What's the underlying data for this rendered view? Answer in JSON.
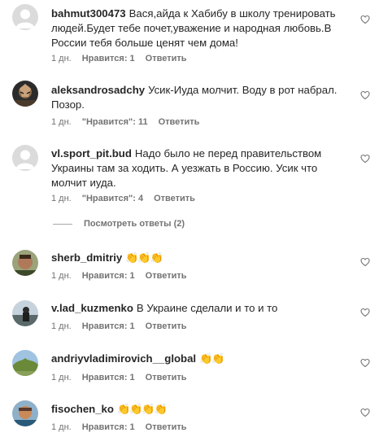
{
  "comments": [
    {
      "username": "bahmut300473",
      "text": "Вася,айда к Хабибу в школу тренировать людей.Будет тебе почет,уважение и народная любовь.В России тебя больше ценят чем дома!",
      "time": "1 дн.",
      "likes": "Нравится: 1",
      "reply": "Ответить"
    },
    {
      "username": "aleksandrosadchy",
      "text": "Усик-Иуда молчит. Воду в рот набрал. Позор.",
      "time": "1 дн.",
      "likes": "\"Нравится\": 11",
      "reply": "Ответить"
    },
    {
      "username": "vl.sport_pit.bud",
      "text": "Надо было не перед правительством Украины там за ходить. А уезжать в Россию. Усик что молчит иуда.",
      "time": "1 дн.",
      "likes": "\"Нравится\": 4",
      "reply": "Ответить"
    },
    {
      "username": "sherb_dmitriy",
      "text": "👏👏👏",
      "time": "1 дн.",
      "likes": "Нравится: 1",
      "reply": "Ответить"
    },
    {
      "username": "v.lad_kuzmenko",
      "text": "В Украине сделали и то и то",
      "time": "1 дн.",
      "likes": "Нравится: 1",
      "reply": "Ответить"
    },
    {
      "username": "andriyvladimirovich__global",
      "text": "👏👏",
      "time": "1 дн.",
      "likes": "Нравится: 1",
      "reply": "Ответить"
    },
    {
      "username": "fisochen_ko",
      "text": "👏👏👏👏",
      "time": "1 дн.",
      "likes": "Нравится: 1",
      "reply": "Ответить"
    }
  ],
  "view_replies": "Посмотреть ответы (2)",
  "icons": {
    "like": "heart-outline-icon"
  },
  "colors": {
    "meta_text": "#737373",
    "text": "#262626"
  }
}
